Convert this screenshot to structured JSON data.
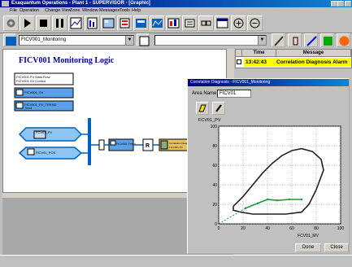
{
  "window": {
    "title": "Exaquantum Operations - Plant 1 - SUPERVISOR - [Graphic]"
  },
  "menu": [
    "File",
    "Operation",
    "Change View",
    "Zone",
    "Window",
    "Messages",
    "Tools",
    "Help"
  ],
  "toolbar2": {
    "graphic_combo": "FICV001_Monitoring",
    "zoom_combo": ""
  },
  "diagram": {
    "title": "FICV001 Monitoring Logic",
    "nodes": [
      {
        "line1": "FICV001.PV  Data Flow",
        "line2": "FICV001.SV  Control"
      },
      {
        "line1": "FICV001_SV",
        "line2": ""
      },
      {
        "line1": "FICV001_PV_TREND",
        "line2": "Trend"
      }
    ],
    "inputs": [
      "FCV01_PV",
      "FICV01_POS"
    ],
    "func_label": "FICV001 Trend",
    "msg_label": "Correlation Diagnosis Alarm",
    "msg_label2": "FICV001 PV"
  },
  "alarm": {
    "col_time": "Time",
    "col_message": "Message",
    "row_time": "13:42:43",
    "row_message": "Correlation Diagnosis Alarm"
  },
  "dialog": {
    "title": "Correlation Diagnosis - FICV001_Monitoring",
    "area_label": "Area Name",
    "area_value": "FICV01",
    "y_label": "FCV01_PV",
    "x_label": "FCV01_MV",
    "done": "Done",
    "close": "Close"
  },
  "chart_data": {
    "type": "scatter",
    "title": "",
    "xlabel": "FCV01_MV",
    "ylabel": "FCV01_PV",
    "xlim": [
      0,
      100
    ],
    "ylim": [
      0,
      100
    ],
    "xticks": [
      0,
      20,
      40,
      60,
      80,
      100
    ],
    "yticks": [
      0,
      20,
      40,
      60,
      80,
      100
    ],
    "grid": true,
    "series": [
      {
        "name": "",
        "color": "#202020",
        "values": [
          [
            12,
            18
          ],
          [
            20,
            28
          ],
          [
            28,
            40
          ],
          [
            36,
            52
          ],
          [
            44,
            62
          ],
          [
            52,
            70
          ],
          [
            60,
            75
          ],
          [
            68,
            77
          ],
          [
            77,
            74
          ],
          [
            84,
            66
          ],
          [
            86,
            55
          ],
          [
            80,
            35
          ],
          [
            74,
            20
          ],
          [
            68,
            12
          ],
          [
            55,
            10
          ],
          [
            40,
            10
          ],
          [
            28,
            10
          ],
          [
            18,
            12
          ],
          [
            12,
            14
          ],
          [
            12,
            18
          ]
        ]
      },
      {
        "name": "",
        "color": "#1a9a3a",
        "values": [
          [
            22,
            16
          ],
          [
            32,
            21
          ],
          [
            40,
            25
          ],
          [
            48,
            24
          ],
          [
            58,
            25
          ],
          [
            68,
            25
          ]
        ]
      },
      {
        "name": "",
        "color": "#1a9a3a",
        "dashed": true,
        "values": [
          [
            0,
            0
          ],
          [
            22,
            16
          ]
        ]
      }
    ]
  }
}
